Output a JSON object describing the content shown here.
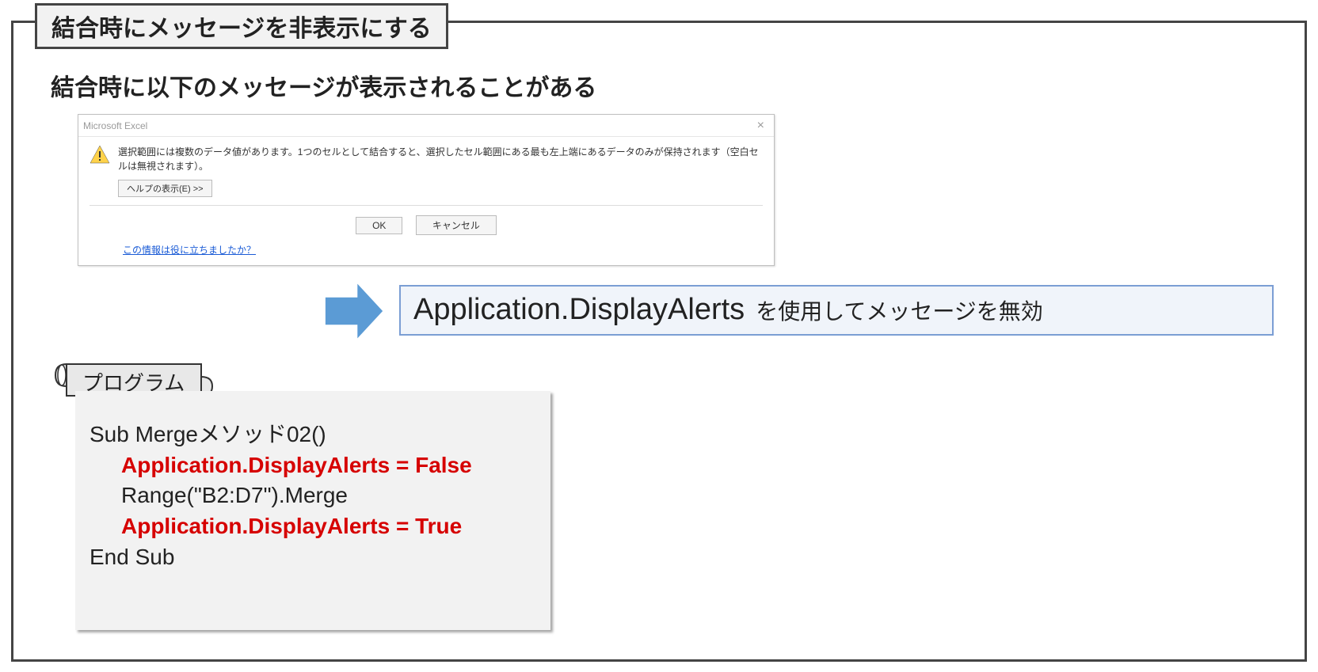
{
  "frame": {
    "title": "結合時にメッセージを非表示にする"
  },
  "intro": "結合時に以下のメッセージが表示されることがある",
  "dialog": {
    "title": "Microsoft Excel",
    "message": "選択範囲には複数のデータ値があります。1つのセルとして結合すると、選択したセル範囲にある最も左上端にあるデータのみが保持されます（空白セルは無視されます）。",
    "help_button": "ヘルプの表示(E) >>",
    "ok": "OK",
    "cancel": "キャンセル",
    "footer_link": "この情報は役に立ちましたか？"
  },
  "solution": {
    "code": "Application.DisplayAlerts",
    "text": "を使用してメッセージを無効"
  },
  "program": {
    "label": "プログラム",
    "lines": {
      "l1": "Sub Mergeメソッド02()",
      "l2": "Application.DisplayAlerts = False",
      "l3": "Range(\"B2:D7\").Merge",
      "l4": "Application.DisplayAlerts = True",
      "l5": "End Sub"
    }
  }
}
